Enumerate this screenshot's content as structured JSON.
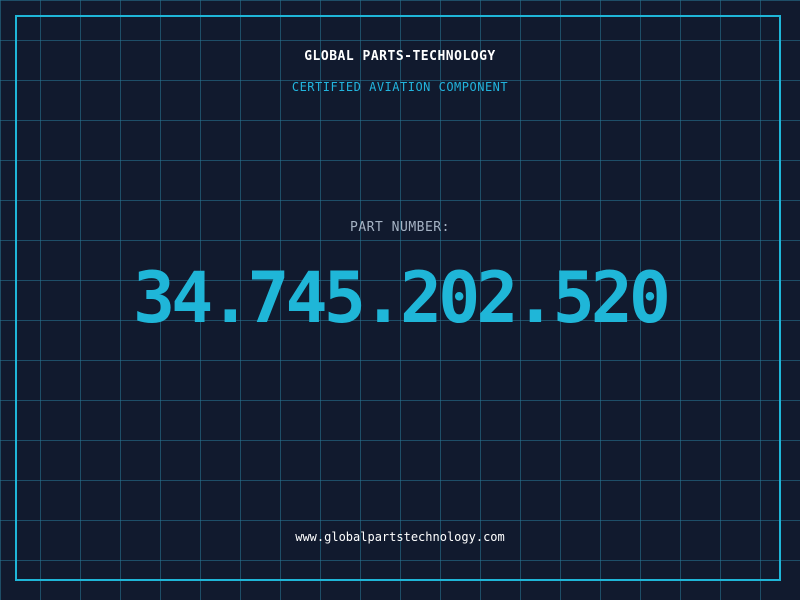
{
  "header": {
    "company": "GLOBAL PARTS-TECHNOLOGY",
    "subtitle": "CERTIFIED AVIATION COMPONENT"
  },
  "part": {
    "label": "PART NUMBER:",
    "number": "34.745.202.520"
  },
  "footer": {
    "website": "www.globalpartstechnology.com"
  },
  "colors": {
    "background": "#111a2e",
    "grid": "#28789a",
    "accent": "#1fb6d8",
    "label": "#a6b3c4",
    "text": "#ffffff"
  }
}
